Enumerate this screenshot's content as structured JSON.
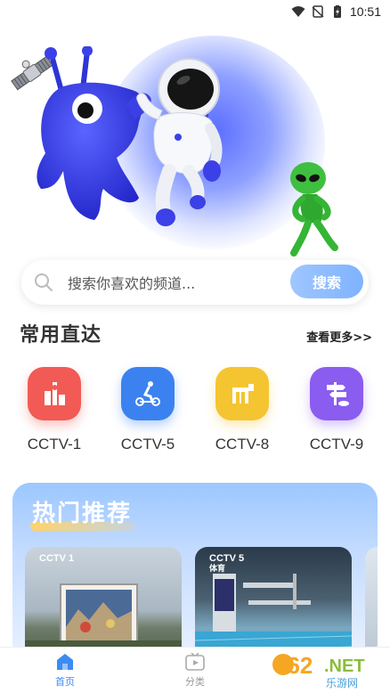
{
  "status_bar": {
    "time": "10:51"
  },
  "search": {
    "placeholder": "搜索你喜欢的频道...",
    "button_label": "搜索"
  },
  "quick_access": {
    "title": "常用直达",
    "more_label": "查看更多>>",
    "channels": [
      {
        "name": "CCTV-1",
        "color": "#f25a55",
        "icon": "building-icon"
      },
      {
        "name": "CCTV-5",
        "color": "#3b82f0",
        "icon": "scooter-icon"
      },
      {
        "name": "CCTV-8",
        "color": "#f5c431",
        "icon": "movie-icon"
      },
      {
        "name": "CCTV-9",
        "color": "#8b5cf0",
        "icon": "signpost-icon"
      }
    ]
  },
  "hot": {
    "title": "热门推荐",
    "thumbnails": [
      {
        "logo": "CCTV 1"
      },
      {
        "logo": "CCTV 5",
        "sub": "体育"
      }
    ]
  },
  "bottom_nav": {
    "items": [
      {
        "label": "首页",
        "active": true
      },
      {
        "label": "分类",
        "active": false
      }
    ]
  },
  "watermark": {
    "brand": "962.NET",
    "sub": "乐游网"
  },
  "colors": {
    "accent": "#3d8bf2",
    "inactive": "#999999"
  }
}
